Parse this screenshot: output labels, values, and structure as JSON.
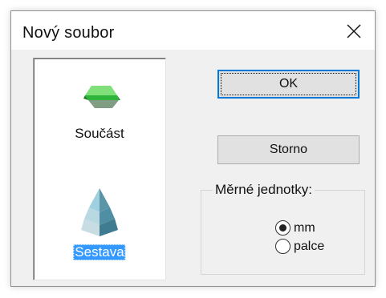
{
  "dialog": {
    "title": "Nový soubor",
    "close_icon": "close-icon"
  },
  "file_types": {
    "items": [
      {
        "label": "Součást",
        "icon": "part-icon",
        "selected": false
      },
      {
        "label": "Sestava",
        "icon": "assembly-icon",
        "selected": true
      }
    ]
  },
  "buttons": {
    "ok_label": "OK",
    "cancel_label": "Storno"
  },
  "units": {
    "group_title": "Měrné jednotky:",
    "options": [
      {
        "label": "mm",
        "checked": true
      },
      {
        "label": "palce",
        "checked": false
      }
    ]
  },
  "colors": {
    "selection": "#3399ff",
    "focus_border": "#0078d7",
    "part_green": "#2fb53a",
    "assembly_teal": "#4a9bb5"
  }
}
